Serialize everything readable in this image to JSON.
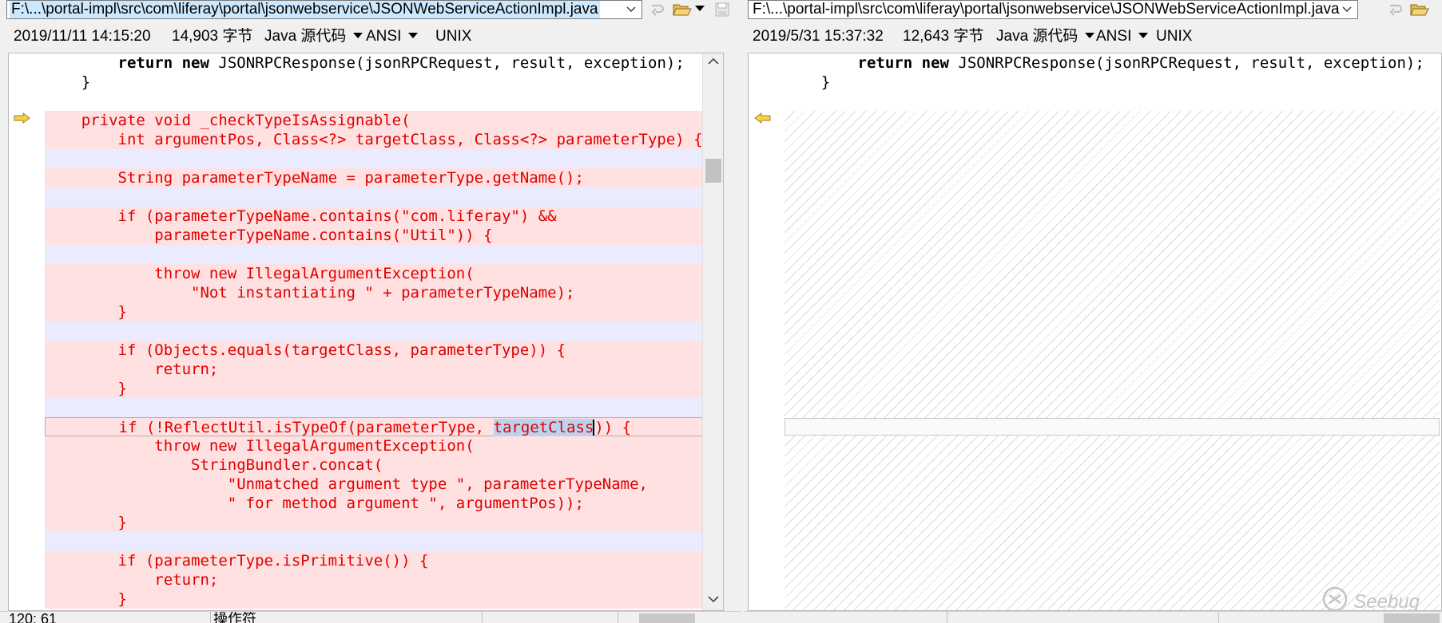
{
  "left": {
    "path": "F:\\...\\portal-impl\\src\\com\\liferay\\portal\\jsonwebservice\\JSONWebServiceActionImpl.java",
    "date": "2019/11/11 14:15:20",
    "size": "14,903 字节",
    "syntax": "Java 源代码",
    "encoding": "ANSI",
    "line_ending": "UNIX",
    "status_position": "120: 61",
    "status_mode": "操作符",
    "lines": {
      "l1": "        return new JSONRPCResponse(jsonRPCRequest, result, exception);",
      "l2": "    }",
      "l3": "    private void _checkTypeIsAssignable(",
      "l4": "        int argumentPos, Class<?> targetClass, Class<?> parameterType) {",
      "l5": "        String parameterTypeName = parameterType.getName();",
      "l6": "        if (parameterTypeName.contains(\"com.liferay\") &&",
      "l7": "            parameterTypeName.contains(\"Util\")) {",
      "l8": "            throw new IllegalArgumentException(",
      "l9": "                \"Not instantiating \" + parameterTypeName);",
      "l10": "        }",
      "l11": "        if (Objects.equals(targetClass, parameterType)) {",
      "l12": "            return;",
      "l13": "        }",
      "l14_pre": "        if (!ReflectUtil.isTypeOf(parameterType, ",
      "l14_sel": "targetClass",
      "l14_post": ")) {",
      "l15": "            throw new IllegalArgumentException(",
      "l16": "                StringBundler.concat(",
      "l17": "                    \"Unmatched argument type \", parameterTypeName,",
      "l18": "                    \" for method argument \", argumentPos));",
      "l19": "        }",
      "l20": "        if (parameterType.isPrimitive()) {",
      "l21": "            return;",
      "l22": "        }"
    }
  },
  "right": {
    "path": "F:\\...\\portal-impl\\src\\com\\liferay\\portal\\jsonwebservice\\JSONWebServiceActionImpl.java",
    "date": "2019/5/31 15:37:32",
    "size": "12,643 字节",
    "syntax": "Java 源代码",
    "encoding": "ANSI",
    "line_ending": "UNIX",
    "lines": {
      "l1": "        return new JSONRPCResponse(jsonRPCRequest, result, exception);",
      "l2": "    }"
    }
  },
  "watermark": "Seebug",
  "colors": {
    "deleted_bg": "#ffe1e1",
    "deleted_text": "#e00000",
    "gap_bg": "#ebebff",
    "selection": "#bcd3ef",
    "path_highlight": "#cce8ff"
  }
}
